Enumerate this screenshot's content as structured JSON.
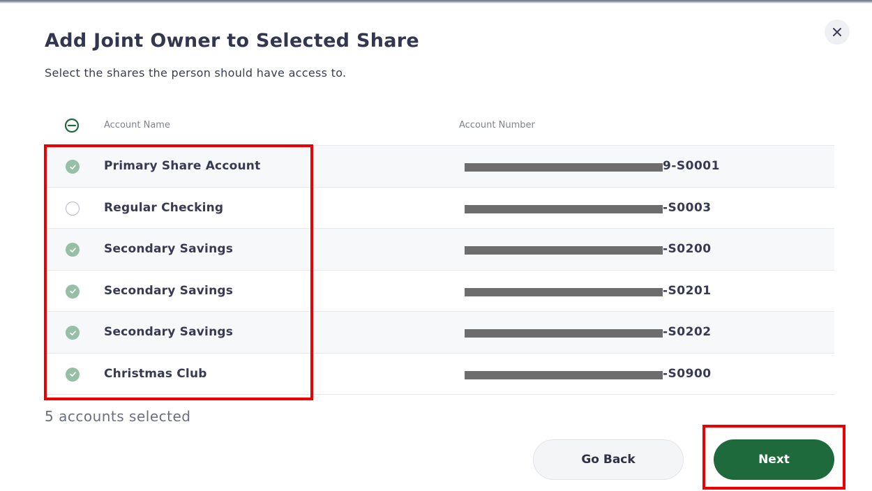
{
  "dialog": {
    "title": "Add Joint Owner to Selected Share",
    "subtitle": "Select the shares the person should have access to."
  },
  "table": {
    "headers": {
      "name": "Account Name",
      "number": "Account Number"
    },
    "rows": [
      {
        "name": "Primary Share Account",
        "number_suffix": "9-S0001",
        "selected": true
      },
      {
        "name": "Regular Checking",
        "number_suffix": "-S0003",
        "selected": false
      },
      {
        "name": "Secondary Savings",
        "number_suffix": "-S0200",
        "selected": true
      },
      {
        "name": "Secondary Savings",
        "number_suffix": "-S0201",
        "selected": true
      },
      {
        "name": "Secondary Savings",
        "number_suffix": "-S0202",
        "selected": true
      },
      {
        "name": "Christmas Club",
        "number_suffix": "-S0900",
        "selected": true
      }
    ]
  },
  "footer": {
    "selected_count": "5 accounts selected",
    "back_label": "Go Back",
    "next_label": "Next"
  },
  "icons": {
    "close": "close-icon",
    "header_toggle": "minus-circle-icon",
    "row_selected": "check-circle-icon",
    "row_unselected": "empty-circle-icon"
  },
  "colors": {
    "primary": "#1f6a3c",
    "check_selected": "#97bfa6",
    "annotation": "#ef0000",
    "text_dark": "#33364f"
  }
}
